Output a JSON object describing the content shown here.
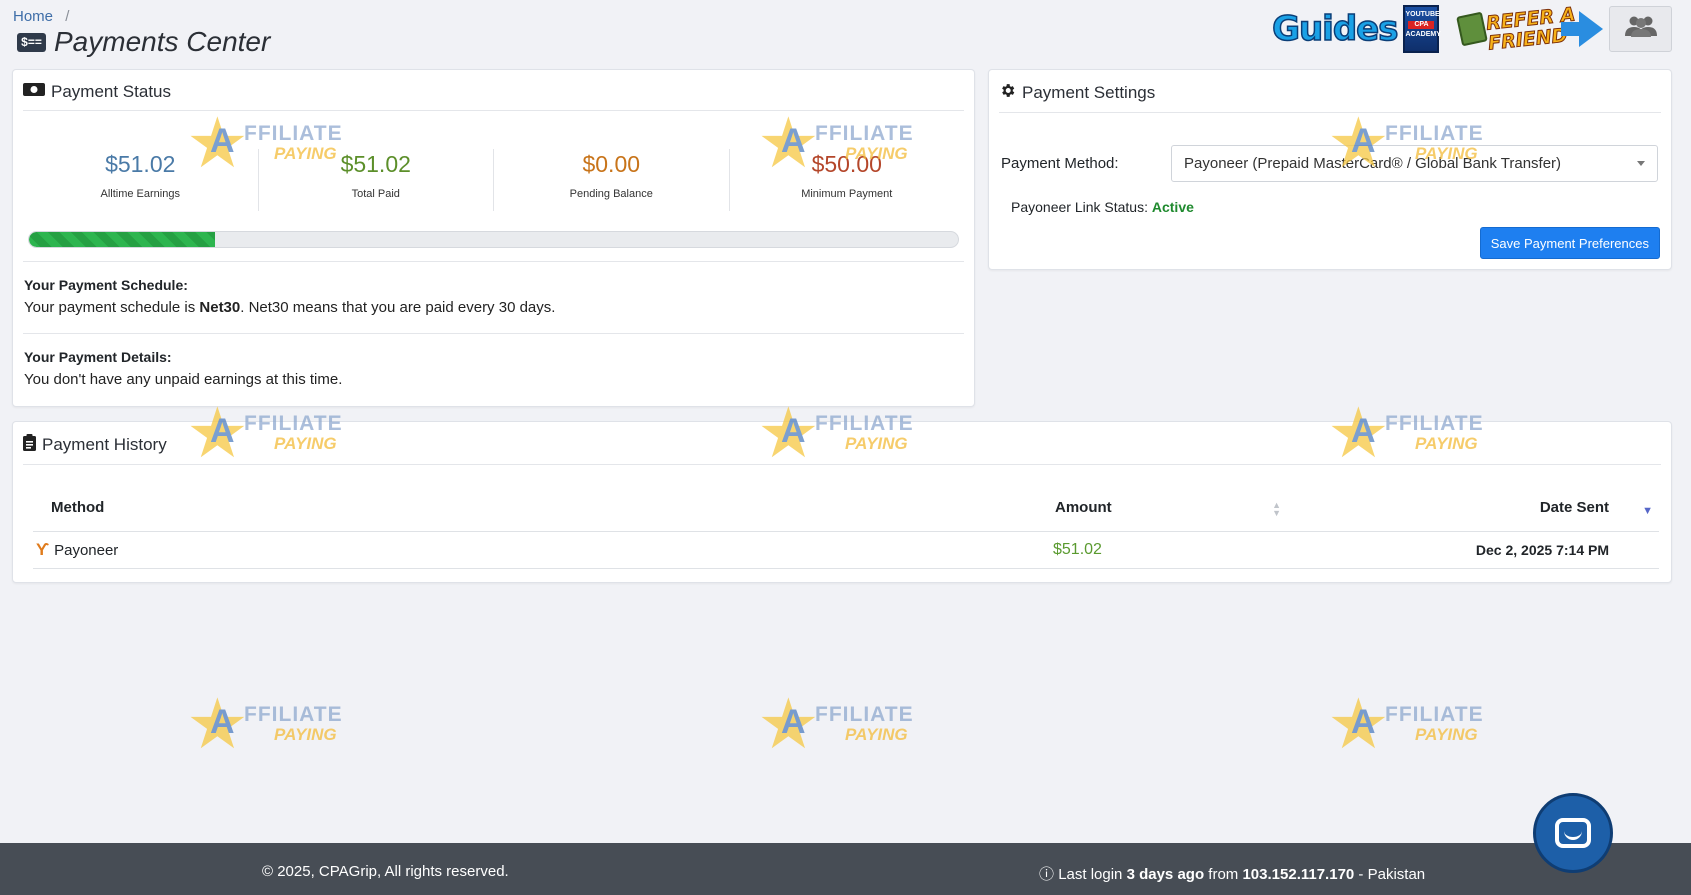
{
  "breadcrumb": {
    "home": "Home",
    "separator": "/"
  },
  "page": {
    "title": "Payments Center",
    "title_icon": "money-bill-icon"
  },
  "header": {
    "guides": "Guides",
    "book_line1": "YOUTUBE",
    "book_line2": "CPA",
    "book_line3": "ACADEMY",
    "refer_line1": "REFER A",
    "refer_line2": "FRIEND",
    "users_icon": "users-icon"
  },
  "status": {
    "title": "Payment Status",
    "stats": [
      {
        "value": "$51.02",
        "label": "Alltime Earnings",
        "color": "#4a7aa7"
      },
      {
        "value": "$51.02",
        "label": "Total Paid",
        "color": "#5c8f2a"
      },
      {
        "value": "$0.00",
        "label": "Pending Balance",
        "color": "#c8741a"
      },
      {
        "value": "$50.00",
        "label": "Minimum Payment",
        "color": "#b4462a"
      }
    ],
    "progress_percent": 20,
    "schedule_title": "Your Payment Schedule:",
    "schedule_prefix": "Your payment schedule is ",
    "schedule_term": "Net30",
    "schedule_suffix": ". Net30 means that you are paid every 30 days.",
    "details_title": "Your Payment Details:",
    "details_text": "You don't have any unpaid earnings at this time."
  },
  "settings": {
    "title": "Payment Settings",
    "method_label": "Payment Method:",
    "method_value": "Payoneer (Prepaid MasterCard® / Global Bank Transfer)",
    "link_status_label": "Payoneer Link Status:",
    "link_status_value": "Active",
    "save_label": "Save Payment Preferences"
  },
  "history": {
    "title": "Payment History",
    "columns": [
      "Method",
      "Amount",
      "Date Sent"
    ],
    "rows": [
      {
        "method": "Payoneer",
        "amount": "$51.02",
        "date": "Dec 2, 2025 7:14 PM"
      }
    ]
  },
  "watermark": {
    "line1": "FFILIATE",
    "line2": "PAYING",
    "letter": "A"
  },
  "footer": {
    "copyright": "© 2025, CPAGrip, All rights reserved.",
    "login_prefix": "Last login ",
    "login_when": "3 days ago",
    "login_from": " from ",
    "login_ip": "103.152.117.170",
    "login_country": " - Pakistan"
  }
}
